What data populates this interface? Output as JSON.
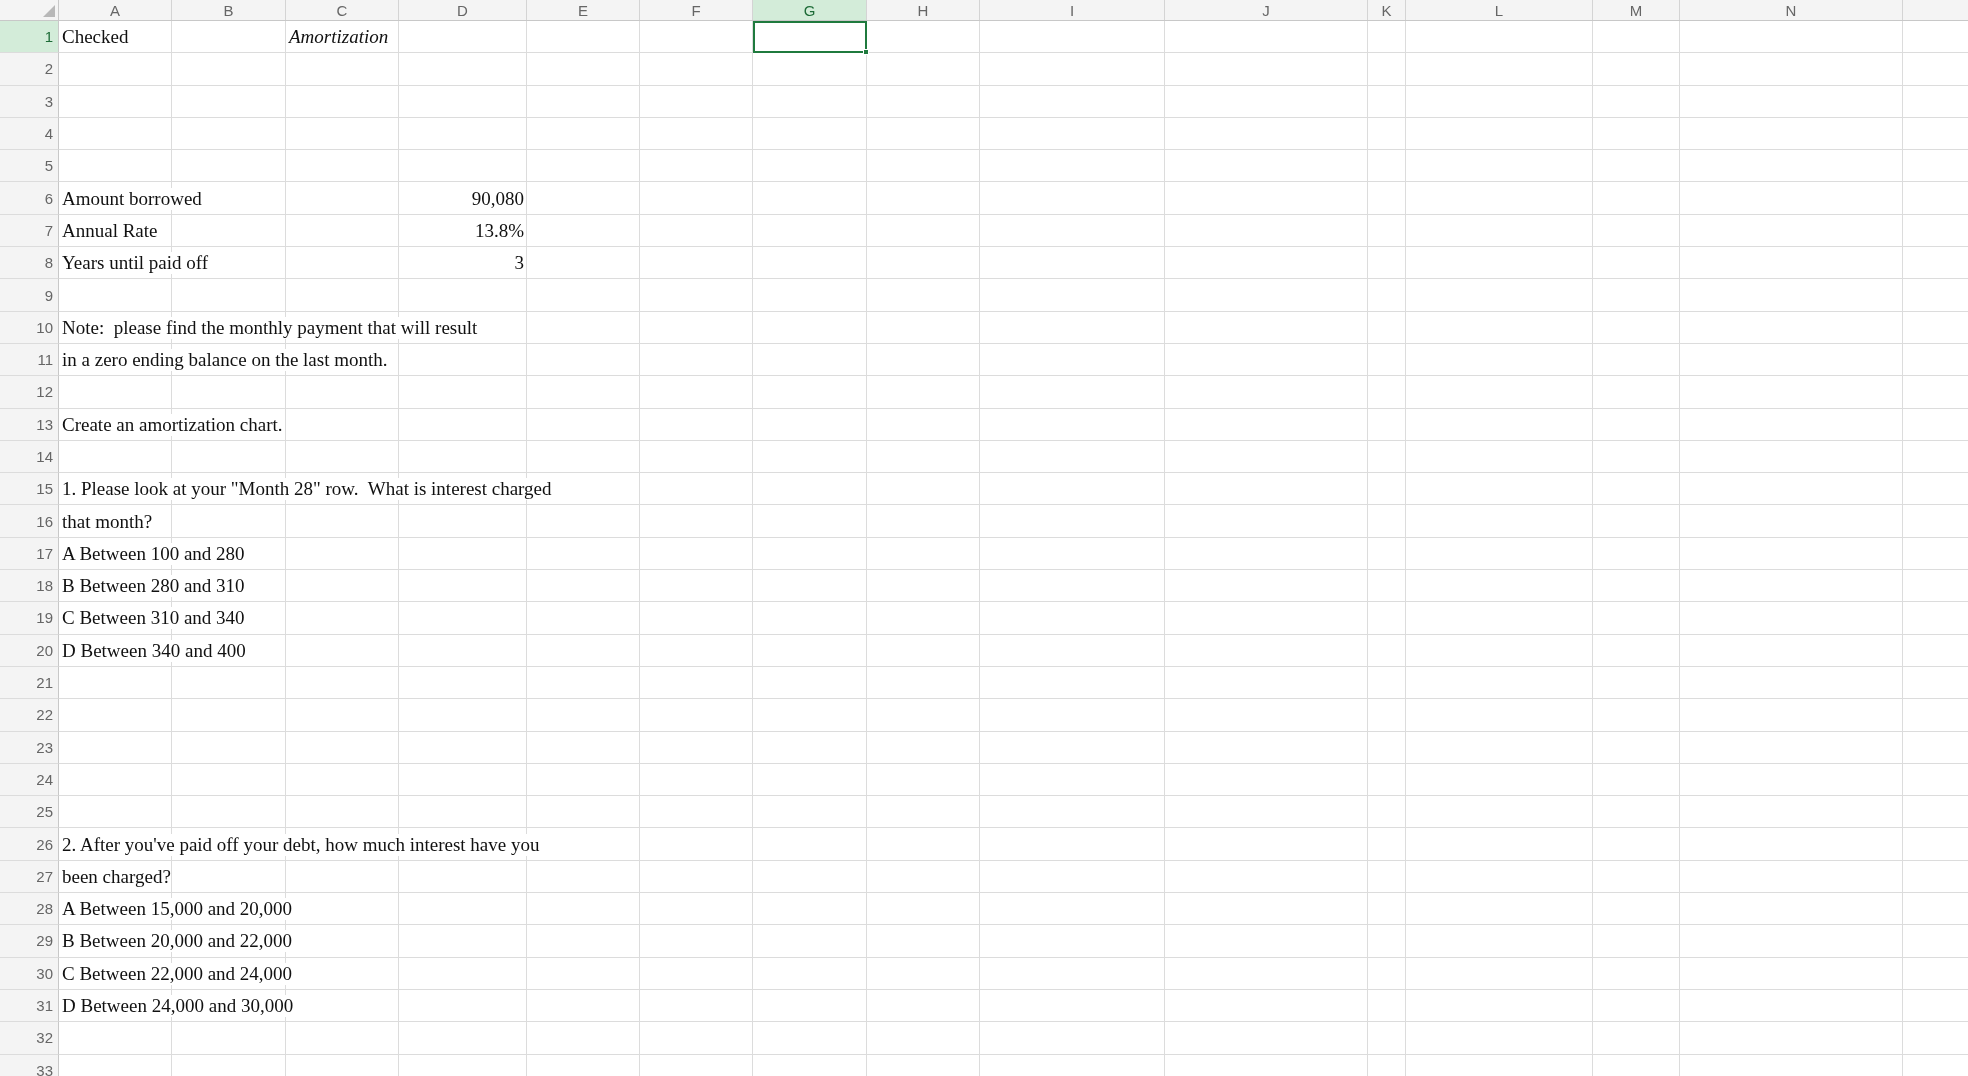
{
  "columns": [
    {
      "label": "A",
      "selected": false
    },
    {
      "label": "B",
      "selected": false
    },
    {
      "label": "C",
      "selected": false
    },
    {
      "label": "D",
      "selected": false
    },
    {
      "label": "E",
      "selected": false
    },
    {
      "label": "F",
      "selected": false
    },
    {
      "label": "G",
      "selected": true
    },
    {
      "label": "H",
      "selected": false
    },
    {
      "label": "I",
      "selected": false
    },
    {
      "label": "J",
      "selected": false
    },
    {
      "label": "K",
      "selected": false
    },
    {
      "label": "L",
      "selected": false
    },
    {
      "label": "M",
      "selected": false
    },
    {
      "label": "N",
      "selected": false
    }
  ],
  "rows": [
    {
      "number": "1",
      "selected": true,
      "cells": [
        {
          "kind": "label",
          "text": "Checked"
        },
        {
          "kind": "title",
          "text": "Amortization"
        }
      ]
    },
    {
      "number": "2",
      "selected": false,
      "cells": []
    },
    {
      "number": "3",
      "selected": false,
      "cells": []
    },
    {
      "number": "4",
      "selected": false,
      "cells": []
    },
    {
      "number": "5",
      "selected": false,
      "cells": []
    },
    {
      "number": "6",
      "selected": false,
      "cells": [
        {
          "kind": "label",
          "text": "Amount borrowed"
        },
        {
          "kind": "number",
          "text": "90,080"
        }
      ]
    },
    {
      "number": "7",
      "selected": false,
      "cells": [
        {
          "kind": "label",
          "text": "Annual Rate"
        },
        {
          "kind": "number",
          "text": "13.8%"
        }
      ]
    },
    {
      "number": "8",
      "selected": false,
      "cells": [
        {
          "kind": "label",
          "text": "Years until paid off"
        },
        {
          "kind": "number",
          "text": "3"
        }
      ]
    },
    {
      "number": "9",
      "selected": false,
      "cells": []
    },
    {
      "number": "10",
      "selected": false,
      "cells": [
        {
          "kind": "label",
          "text": "Note:  please find the monthly payment that will result"
        }
      ]
    },
    {
      "number": "11",
      "selected": false,
      "cells": [
        {
          "kind": "label",
          "text": "in a zero ending balance on the last month."
        }
      ]
    },
    {
      "number": "12",
      "selected": false,
      "cells": []
    },
    {
      "number": "13",
      "selected": false,
      "cells": [
        {
          "kind": "label",
          "text": "Create an amortization chart."
        }
      ]
    },
    {
      "number": "14",
      "selected": false,
      "cells": []
    },
    {
      "number": "15",
      "selected": false,
      "cells": [
        {
          "kind": "label",
          "text": "1. Please look at your \"Month 28\" row.  What is interest charged"
        }
      ]
    },
    {
      "number": "16",
      "selected": false,
      "cells": [
        {
          "kind": "label",
          "text": "that month?"
        }
      ]
    },
    {
      "number": "17",
      "selected": false,
      "cells": [
        {
          "kind": "label",
          "text": "A Between 100 and 280"
        }
      ]
    },
    {
      "number": "18",
      "selected": false,
      "cells": [
        {
          "kind": "label",
          "text": "B Between 280 and 310"
        }
      ]
    },
    {
      "number": "19",
      "selected": false,
      "cells": [
        {
          "kind": "label",
          "text": "C Between 310 and 340"
        }
      ]
    },
    {
      "number": "20",
      "selected": false,
      "cells": [
        {
          "kind": "label",
          "text": "D Between 340 and 400"
        }
      ]
    },
    {
      "number": "21",
      "selected": false,
      "cells": []
    },
    {
      "number": "22",
      "selected": false,
      "cells": []
    },
    {
      "number": "23",
      "selected": false,
      "cells": []
    },
    {
      "number": "24",
      "selected": false,
      "cells": []
    },
    {
      "number": "25",
      "selected": false,
      "cells": []
    },
    {
      "number": "26",
      "selected": false,
      "cells": [
        {
          "kind": "label",
          "text": "2. After you've paid off your debt, how much interest have you"
        }
      ]
    },
    {
      "number": "27",
      "selected": false,
      "cells": [
        {
          "kind": "label",
          "text": "been charged?"
        }
      ]
    },
    {
      "number": "28",
      "selected": false,
      "cells": [
        {
          "kind": "label",
          "text": "A Between 15,000 and 20,000"
        }
      ]
    },
    {
      "number": "29",
      "selected": false,
      "cells": [
        {
          "kind": "label",
          "text": "B Between 20,000 and 22,000"
        }
      ]
    },
    {
      "number": "30",
      "selected": false,
      "cells": [
        {
          "kind": "label",
          "text": "C Between 22,000 and 24,000"
        }
      ]
    },
    {
      "number": "31",
      "selected": false,
      "cells": [
        {
          "kind": "label",
          "text": "D Between 24,000 and 30,000"
        }
      ]
    },
    {
      "number": "32",
      "selected": false,
      "cells": []
    },
    {
      "number": "33",
      "selected": false,
      "cells": []
    }
  ]
}
